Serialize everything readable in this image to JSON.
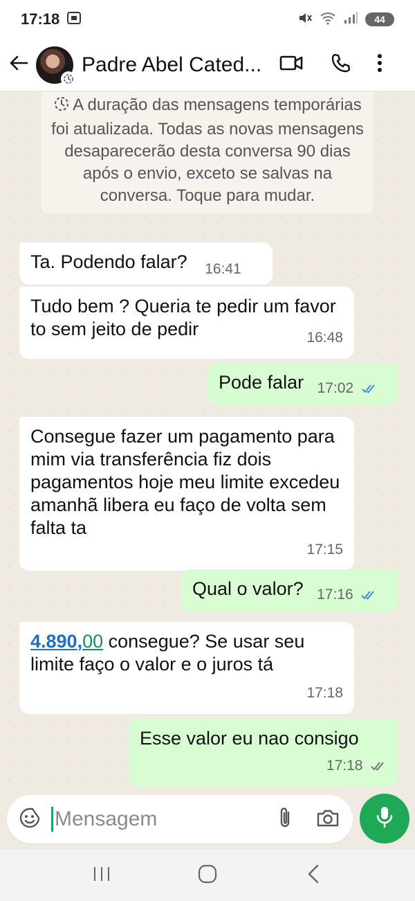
{
  "status_bar": {
    "time": "17:18",
    "battery": "44"
  },
  "header": {
    "contact_name": "Padre Abel Cated..."
  },
  "system_message": {
    "text": "A duração das mensagens temporárias foi atualizada. Todas as novas mensagens desaparecerão desta conversa 90 dias após o envio, exceto se salvas na conversa. Toque para mudar."
  },
  "messages": [
    {
      "direction": "in",
      "text": "Ta. Podendo falar?",
      "time": "16:41"
    },
    {
      "direction": "in",
      "text": "Tudo bem ? Queria te pedir um favor to sem jeito de pedir",
      "time": "16:48"
    },
    {
      "direction": "out",
      "text": "Pode falar",
      "time": "17:02",
      "status": "read"
    },
    {
      "direction": "in",
      "text": "Consegue fazer um pagamento para mim via transferência fiz dois pagamentos hoje meu limite excedeu amanhã libera eu faço de volta sem falta ta",
      "time": "17:15"
    },
    {
      "direction": "out",
      "text": "Qual o valor?",
      "time": "17:16",
      "status": "read"
    },
    {
      "direction": "in",
      "amount_main": "4.890",
      "amount_sep": ",",
      "amount_cents": "00",
      "text_after": " consegue? Se usar seu limite faço o valor e o juros tá",
      "time": "17:18"
    },
    {
      "direction": "out",
      "text": "Esse valor eu nao consigo",
      "time": "17:18",
      "status": "delivered"
    }
  ],
  "composer": {
    "placeholder": "Mensagem"
  },
  "colors": {
    "incoming": "#ffffff",
    "outgoing": "#d9fdd3",
    "accent": "#1fa855",
    "read_tick": "#3b8ce0",
    "chat_bg": "#efeae2"
  }
}
